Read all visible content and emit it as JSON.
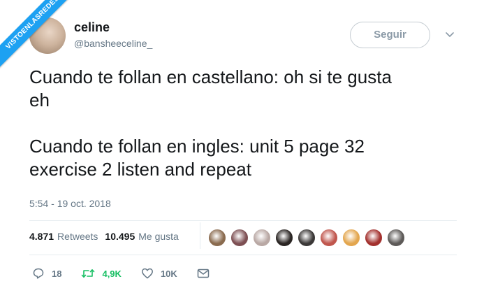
{
  "watermark": "VISTOENLASREDES",
  "user": {
    "display_name": "celine",
    "handle": "@bansheeceline_"
  },
  "follow_button": "Seguir",
  "tweet": {
    "line1": "Cuando te follan en castellano: oh si te gusta",
    "line2": "eh",
    "line3": "Cuando te follan en ingles: unit 5 page 32",
    "line4": "exercise 2 listen and repeat",
    "timestamp": "5:54 - 19 oct. 2018"
  },
  "stats": {
    "retweets_count": "4.871",
    "retweets_label": "Retweets",
    "likes_count": "10.495",
    "likes_label": "Me gusta"
  },
  "likers": [
    {
      "name": "liker-1",
      "color": "#8a6b4f"
    },
    {
      "name": "liker-2",
      "color": "#7d4f53"
    },
    {
      "name": "liker-3",
      "color": "#b9a8a4"
    },
    {
      "name": "liker-4",
      "color": "#2a2523"
    },
    {
      "name": "liker-5",
      "color": "#3b3837"
    },
    {
      "name": "liker-6",
      "color": "#c0564d"
    },
    {
      "name": "liker-7",
      "color": "#e3a64e"
    },
    {
      "name": "liker-8",
      "color": "#a3312e"
    },
    {
      "name": "liker-9",
      "color": "#5d5a58"
    }
  ],
  "actions": {
    "replies": "18",
    "retweets": "4,9K",
    "likes": "10K"
  },
  "colors": {
    "accent": "#1da1f2",
    "retweet": "#17bf63",
    "muted": "#657786"
  }
}
